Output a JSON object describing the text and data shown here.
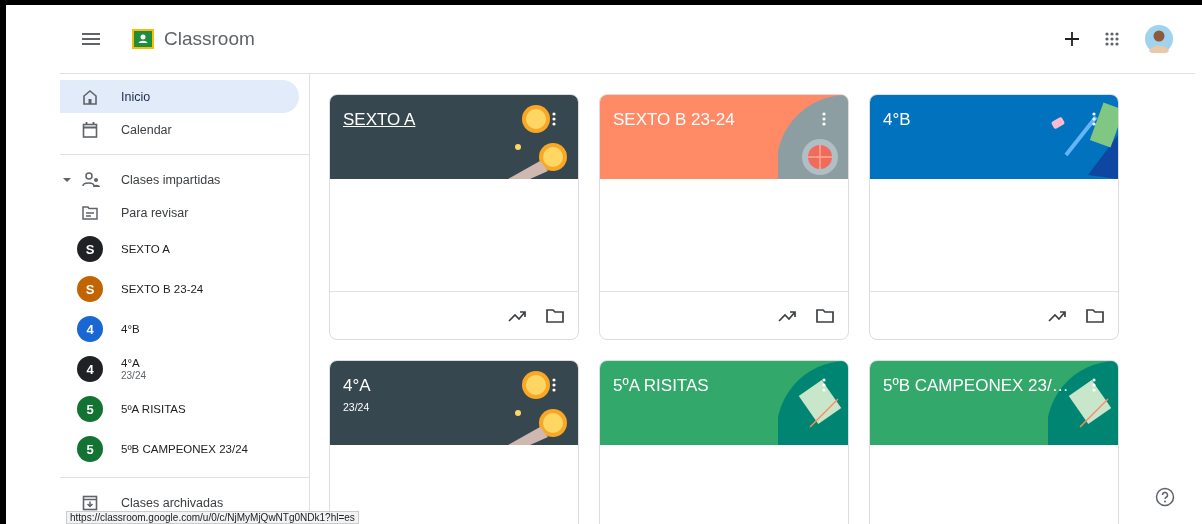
{
  "header": {
    "title": "Classroom"
  },
  "sidebar": {
    "nav": [
      {
        "label": "Inicio",
        "kind": "home",
        "selected": true
      },
      {
        "label": "Calendar",
        "kind": "calendar",
        "selected": false
      }
    ],
    "teaching": {
      "label": "Clases impartidas",
      "expanded": true
    },
    "review": {
      "label": "Para revisar"
    },
    "classes": [
      {
        "initial": "S",
        "name": "SEXTO A",
        "color": "#202124"
      },
      {
        "initial": "S",
        "name": "SEXTO B 23-24",
        "color": "#c26401"
      },
      {
        "initial": "4",
        "name": "4°B",
        "color": "#1967d2"
      },
      {
        "initial": "4",
        "name": "4°A",
        "subtitle": "23/24",
        "color": "#202124"
      },
      {
        "initial": "5",
        "name": "5ºA RISITAS",
        "color": "#137333"
      },
      {
        "initial": "5",
        "name": "5ºB CAMPEONEX 23/24",
        "color": "#137333"
      }
    ],
    "archived": {
      "label": "Clases archivadas"
    }
  },
  "cards": [
    {
      "title": "SEXTO A",
      "kind": "space",
      "hovered": true
    },
    {
      "title": "SEXTO B 23-24",
      "kind": "coral",
      "hovered": false
    },
    {
      "title": "4°B",
      "kind": "blue",
      "hovered": false
    },
    {
      "title": "4°A",
      "subtitle": "23/24",
      "kind": "space",
      "hovered": false
    },
    {
      "title": "5ºA RISITAS",
      "kind": "green",
      "hovered": false
    },
    {
      "title": "5ºB CAMPEONEX 23/…",
      "kind": "green",
      "hovered": false
    }
  ],
  "status_url": "https://classroom.google.com/u/0/c/NjMyMjQwNTg0NDk1?hl=es"
}
